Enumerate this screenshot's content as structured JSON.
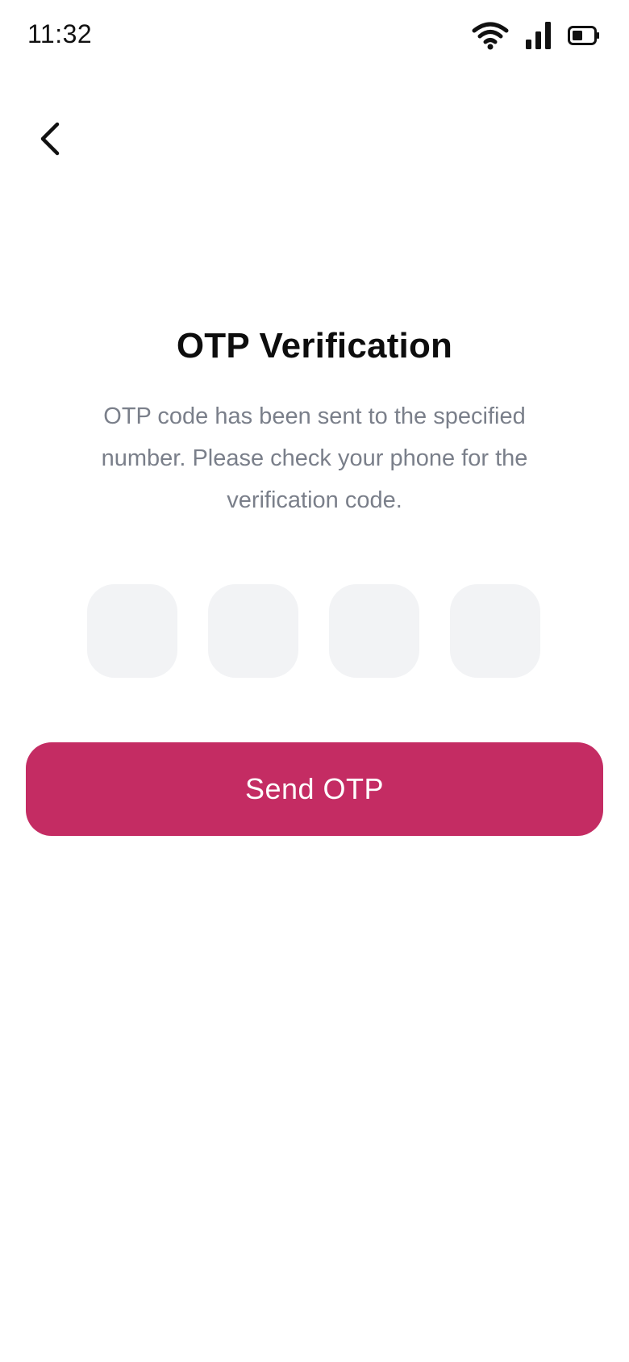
{
  "status_bar": {
    "time": "11:32",
    "icons": [
      "wifi-icon",
      "signal-icon",
      "battery-icon"
    ]
  },
  "header": {
    "back_icon": "chevron-left-icon"
  },
  "main": {
    "title": "OTP Verification",
    "description": "OTP code has been sent to the specified number. Please check your phone for the verification code.",
    "otp_fields": [
      {
        "value": ""
      },
      {
        "value": ""
      },
      {
        "value": ""
      },
      {
        "value": ""
      }
    ],
    "send_button_label": "Send OTP"
  },
  "colors": {
    "accent": "#c42c63",
    "otp_box_bg": "#f2f3f5",
    "description_text": "#7a7f8a",
    "title_text": "#0d0d0d"
  }
}
